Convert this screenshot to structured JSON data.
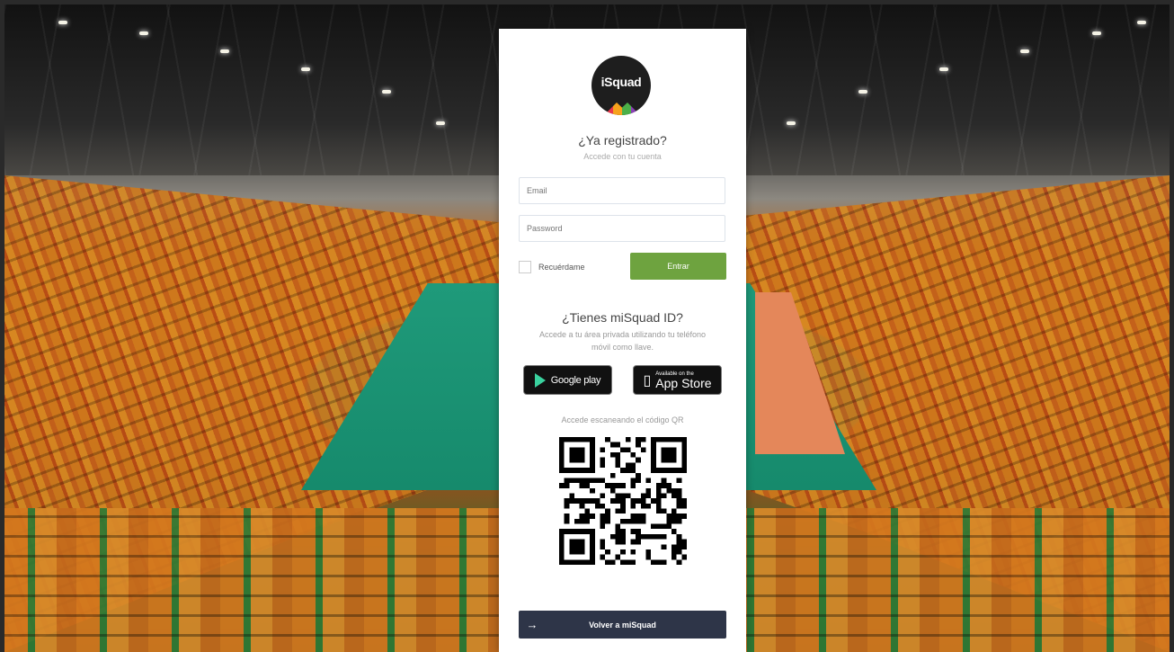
{
  "brand": {
    "logo_text": "iSquad"
  },
  "login": {
    "title": "¿Ya registrado?",
    "subtitle": "Accede con tu cuenta",
    "email_placeholder": "Email",
    "password_placeholder": "Password",
    "remember_label": "Recuérdame",
    "enter_button": "Entrar"
  },
  "miSquad": {
    "title": "¿Tienes miSquad ID?",
    "subtitle": "Accede a tu área privada utilizando tu teléfono móvil como llave.",
    "google_play_label": "Google play",
    "app_store_small": "Available on the",
    "app_store_big": "App Store",
    "qr_caption": "Accede escaneando el código QR"
  },
  "footer": {
    "back_button": "Volver a miSquad",
    "back_icon": "arrow-right-icon"
  },
  "colors": {
    "accent_green": "#6ea33f",
    "footer_navy": "#2e3548"
  }
}
